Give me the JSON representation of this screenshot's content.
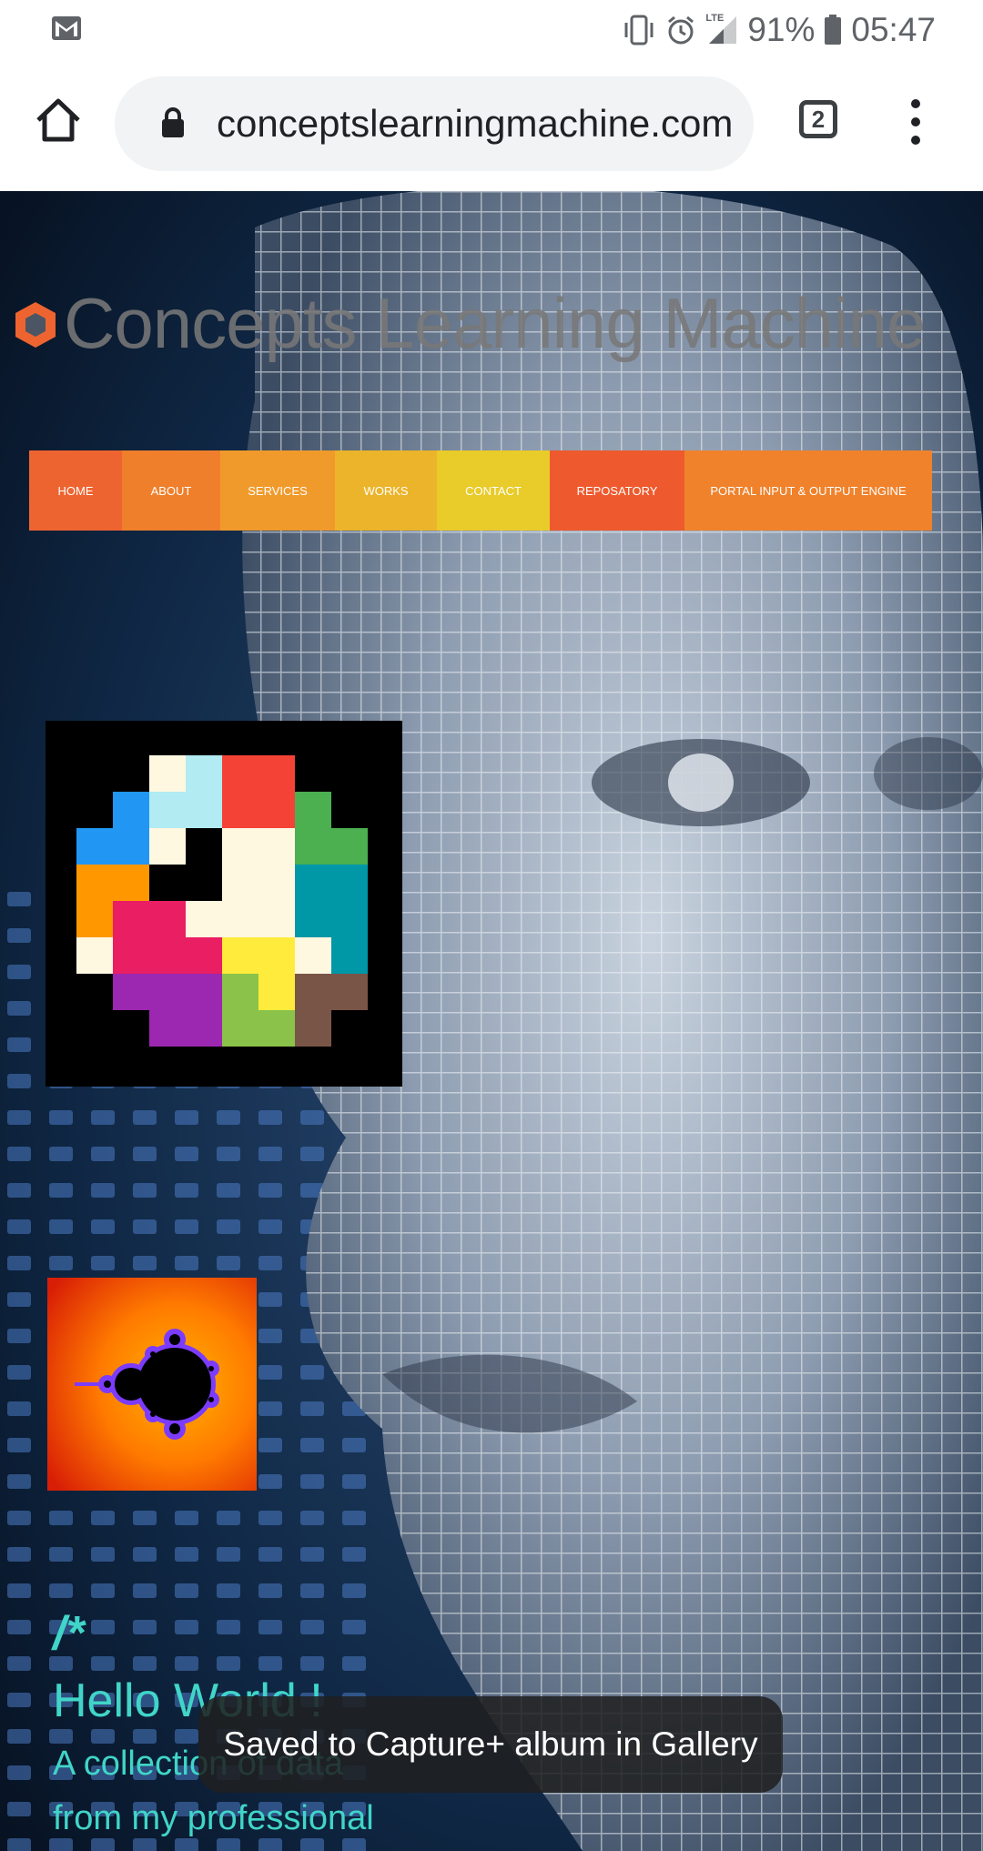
{
  "status_bar": {
    "battery_percent": "91%",
    "time": "05:47",
    "network_label": "LTE",
    "icons": [
      "gmail-icon",
      "vibrate-icon",
      "alarm-icon",
      "signal-icon",
      "battery-icon"
    ]
  },
  "browser": {
    "url": "conceptslearningmachine.com",
    "tab_count": "2",
    "icons": [
      "home-icon",
      "lock-icon",
      "tabs-icon",
      "more-vert-icon"
    ]
  },
  "site": {
    "title": "Concepts Learning Machine",
    "nav": [
      {
        "label": "HOME",
        "color": "#ee6430"
      },
      {
        "label": "ABOUT",
        "color": "#ef7f2b"
      },
      {
        "label": "SERVICES",
        "color": "#f19a2c"
      },
      {
        "label": "WORKS",
        "color": "#ecb42a"
      },
      {
        "label": "CONTACT",
        "color": "#e9cb2a"
      },
      {
        "label": "REPOSATORY",
        "color": "#ee5a2e"
      },
      {
        "label": "PORTAL INPUT & OUTPUT ENGINE",
        "color": "#f0822c"
      }
    ],
    "code_comment": "/*",
    "hello": "Hello World !",
    "line1": "A collection of data",
    "line2": "from my professional"
  },
  "toast": {
    "message": "Saved to Capture+ album in Gallery"
  },
  "colors": {
    "accent_text": "#40d5c8",
    "logo_orange": "#ee6430"
  }
}
